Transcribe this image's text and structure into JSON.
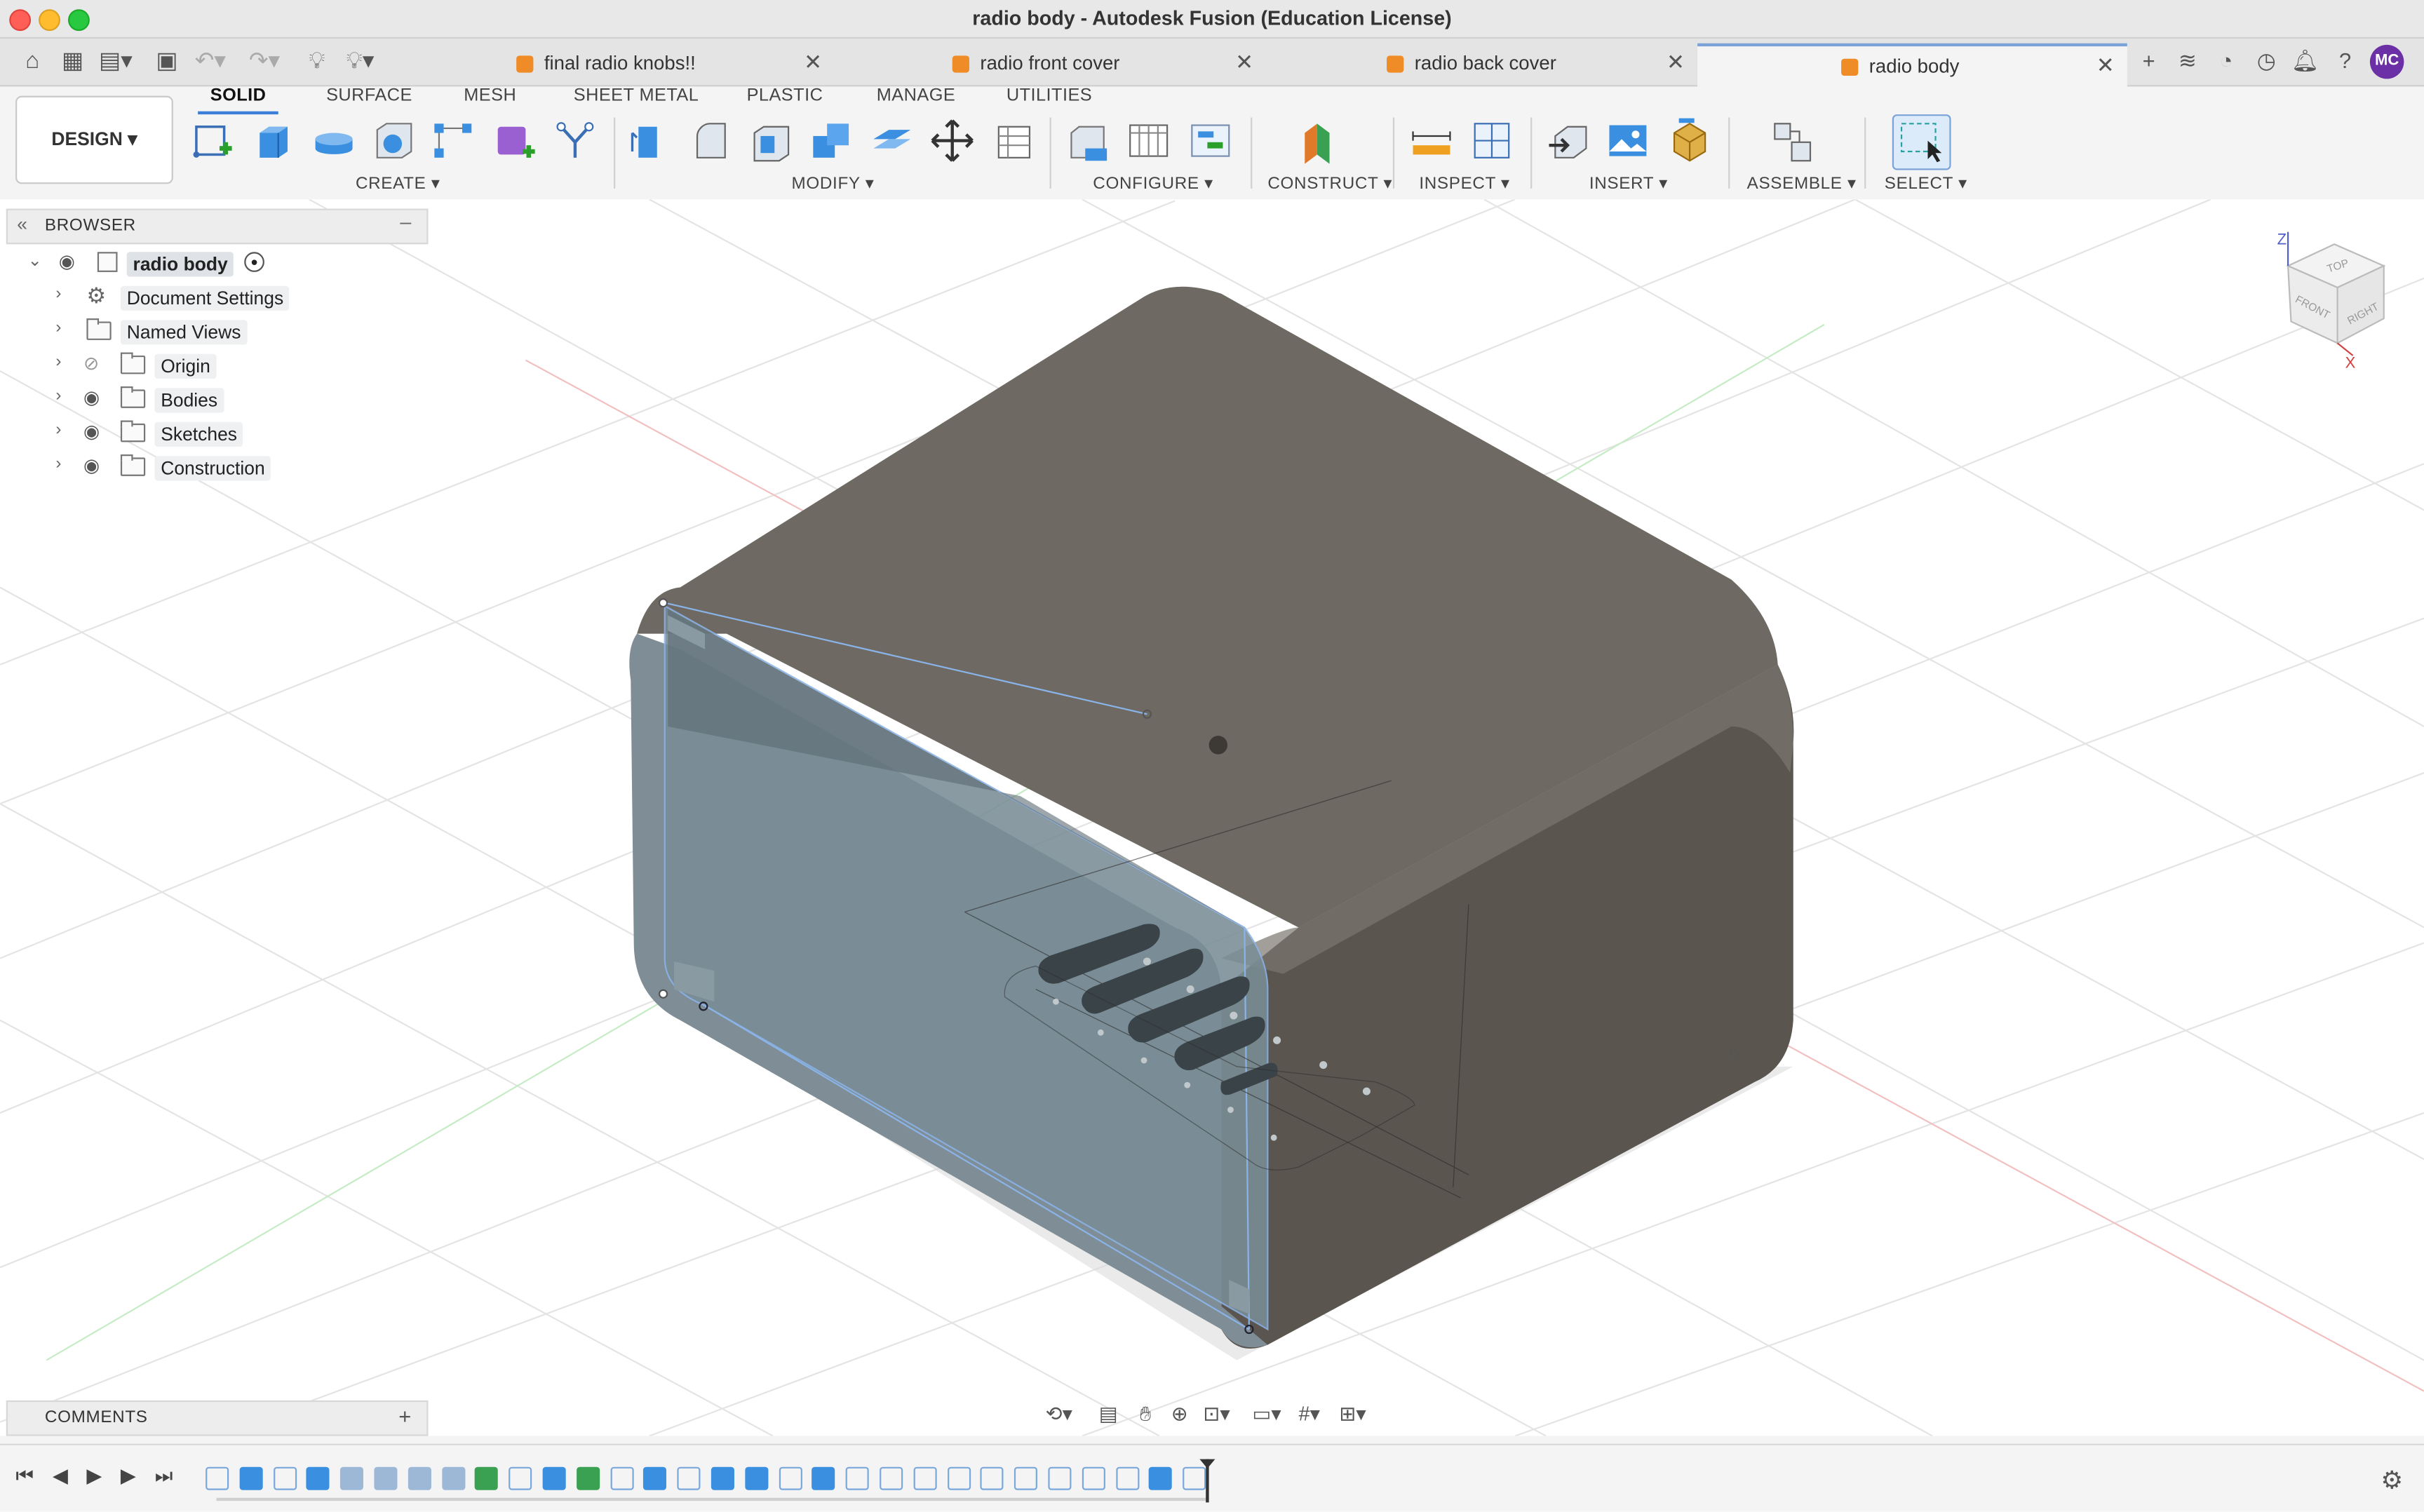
{
  "window": {
    "title": "radio body - Autodesk Fusion (Education License)"
  },
  "tabs": [
    {
      "label": "final radio knobs!!",
      "active": false
    },
    {
      "label": "radio front cover",
      "active": false
    },
    {
      "label": "radio back cover",
      "active": false
    },
    {
      "label": "radio body",
      "active": true
    }
  ],
  "user": {
    "initials": "MC",
    "avatar_color": "#6b2fa6"
  },
  "toolbar": {
    "workspace": "DESIGN",
    "tabs": [
      "SOLID",
      "SURFACE",
      "MESH",
      "SHEET METAL",
      "PLASTIC",
      "MANAGE",
      "UTILITIES"
    ],
    "active_tab": "SOLID",
    "groups": {
      "create": "CREATE",
      "modify": "MODIFY",
      "configure": "CONFIGURE",
      "construct": "CONSTRUCT",
      "inspect": "INSPECT",
      "insert": "INSERT",
      "assemble": "ASSEMBLE",
      "select": "SELECT"
    }
  },
  "browser": {
    "title": "BROWSER",
    "root": "radio body",
    "items": [
      {
        "label": "Document Settings",
        "icon": "gear-icon",
        "visible": null
      },
      {
        "label": "Named Views",
        "icon": "folder-icon",
        "visible": null
      },
      {
        "label": "Origin",
        "icon": "folder-icon",
        "visible": false
      },
      {
        "label": "Bodies",
        "icon": "folder-icon",
        "visible": true
      },
      {
        "label": "Sketches",
        "icon": "folder-icon",
        "visible": true
      },
      {
        "label": "Construction",
        "icon": "folder-icon",
        "visible": true
      }
    ]
  },
  "comments": {
    "title": "COMMENTS"
  },
  "viewcube": {
    "axis_z": "Z",
    "axis_x": "X",
    "face_top": "TOP",
    "face_front": "FRONT",
    "face_right": "RIGHT"
  },
  "colors": {
    "body_main": "#6f6a63",
    "glass": "#7a8d96",
    "accent": "#3b7fd8"
  }
}
